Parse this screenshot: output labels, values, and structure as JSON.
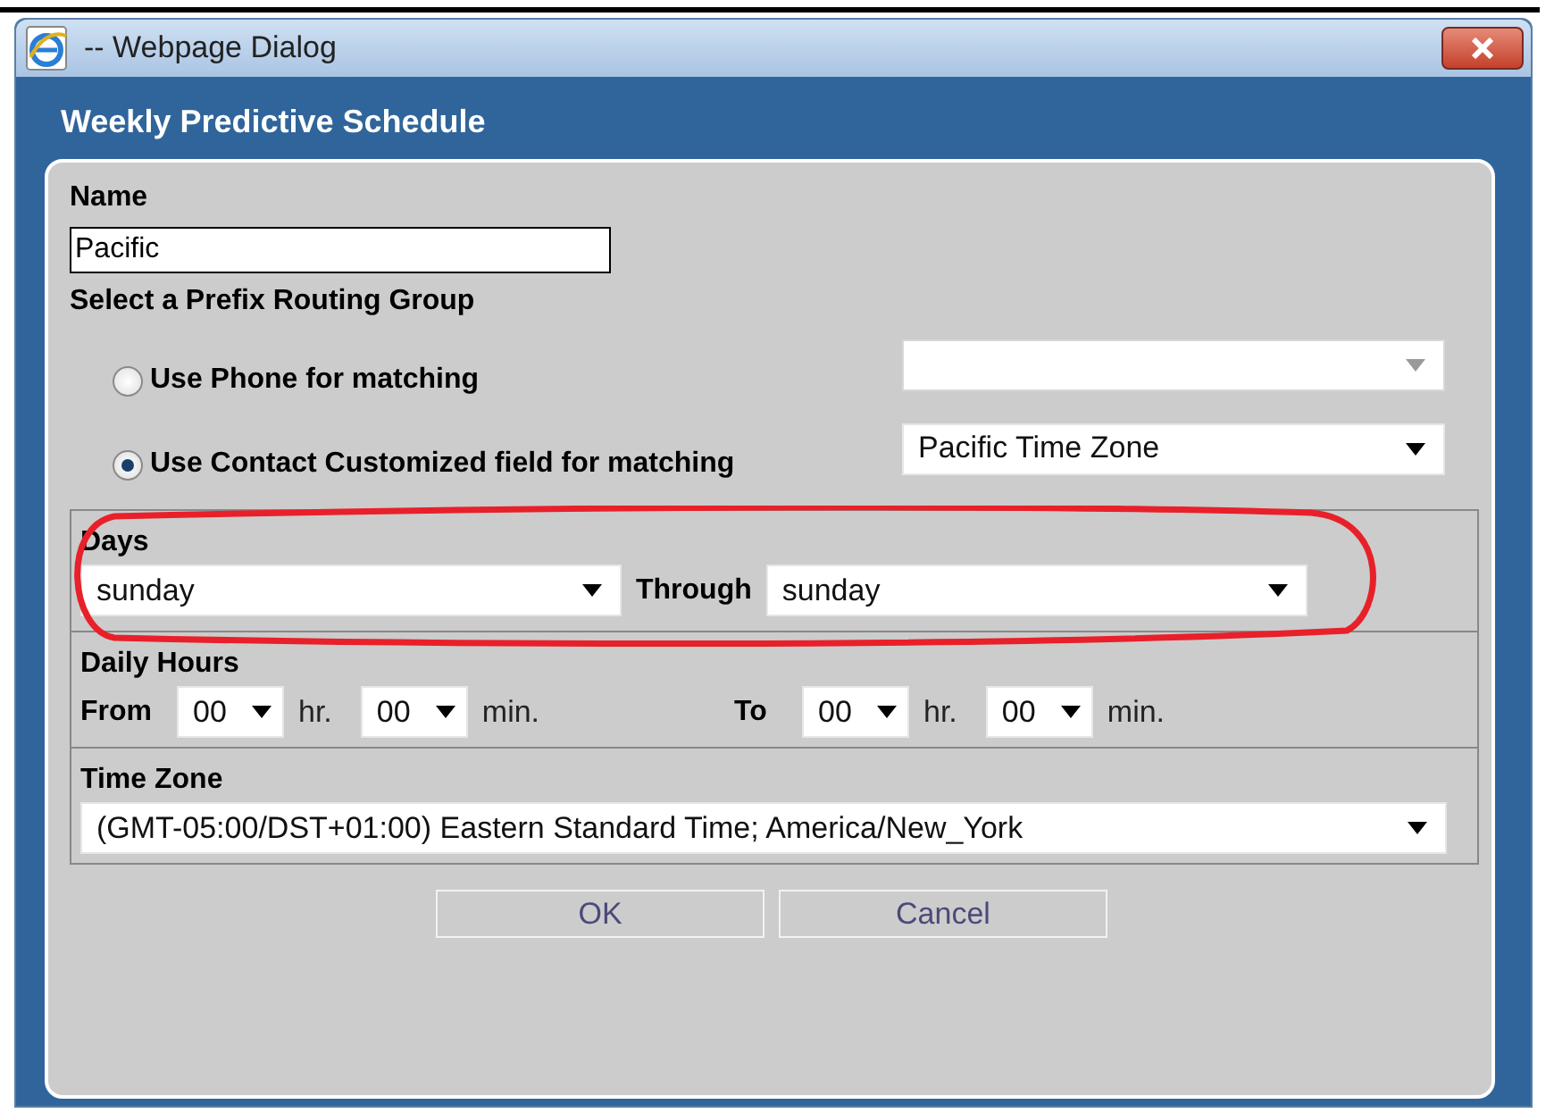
{
  "window": {
    "title": "-- Webpage Dialog"
  },
  "dialog": {
    "title": "Weekly Predictive Schedule"
  },
  "name_field": {
    "label": "Name",
    "value": "Pacific"
  },
  "routing_group": {
    "label": "Select a Prefix Routing Group",
    "options": [
      {
        "label": "Use Phone for matching",
        "selected": false,
        "dropdown": {
          "disabled": true
        }
      },
      {
        "label": "Use Contact Customized field for matching",
        "selected": true,
        "dropdown": {
          "value": "Pacific Time Zone",
          "disabled": false
        }
      }
    ]
  },
  "days": {
    "label": "Days",
    "from": "sunday",
    "through_label": "Through",
    "to": "sunday"
  },
  "daily_hours": {
    "label": "Daily Hours",
    "ranges": [
      {
        "label": "From",
        "hour": "00",
        "hour_unit": "hr.",
        "minute": "00",
        "minute_unit": "min."
      },
      {
        "label": "To",
        "hour": "00",
        "hour_unit": "hr.",
        "minute": "00",
        "minute_unit": "min."
      }
    ]
  },
  "time_zone": {
    "label": "Time Zone",
    "value": "(GMT-05:00/DST+01:00) Eastern Standard Time; America/New_York"
  },
  "buttons": [
    {
      "label": "OK"
    },
    {
      "label": "Cancel"
    }
  ]
}
